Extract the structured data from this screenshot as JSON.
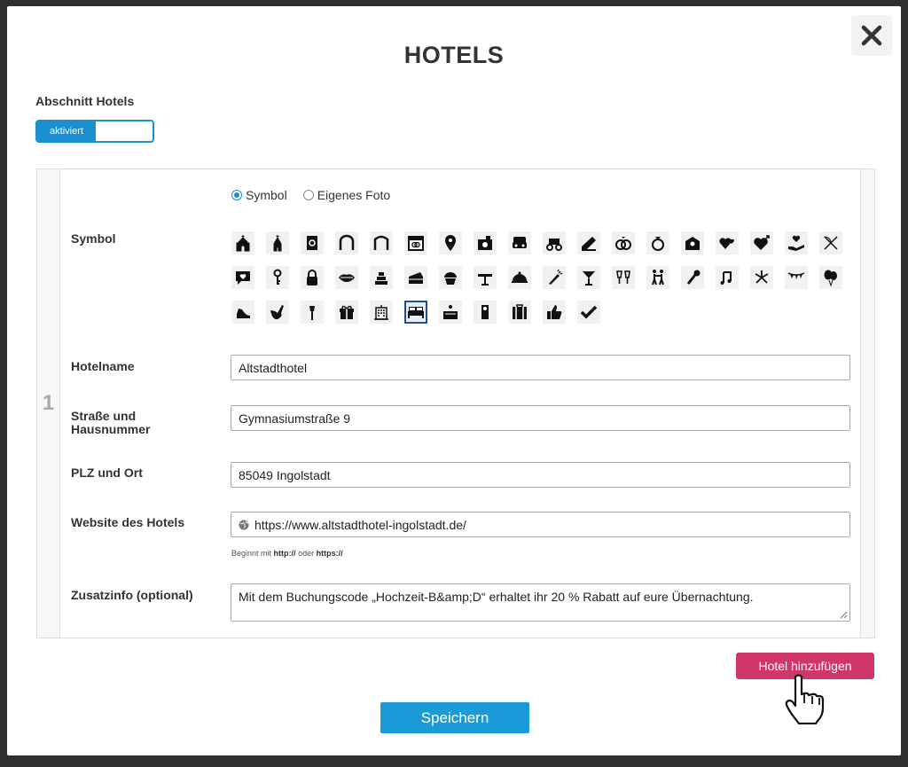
{
  "modal": {
    "title": "HOTELS",
    "section_label": "Abschnitt Hotels",
    "toggle_label": "aktiviert"
  },
  "hotel": {
    "index": "1",
    "radio_options": [
      {
        "label": "Symbol",
        "checked": true
      },
      {
        "label": "Eigenes Foto",
        "checked": false
      }
    ],
    "labels": {
      "symbol": "Symbol",
      "hotelname": "Hotelname",
      "street": "Straße und Hausnummer",
      "city": "PLZ und Ort",
      "website": "Website des Hotels",
      "extra": "Zusatzinfo (optional)"
    },
    "values": {
      "hotelname": "Altstadthotel",
      "street": "Gymnasiumstraße 9",
      "city": "85049 Ingolstadt",
      "website": "https://www.altstadthotel-ingolstadt.de/",
      "extra": "Mit dem Buchungscode „Hochzeit-B&amp;D“ erhaltet ihr 20 % Rabatt auf eure Übernachtung."
    },
    "hint": {
      "prefix": "Beginnt mit",
      "http": "http://",
      "or": "oder",
      "https": "https://"
    },
    "symbols": [
      "church-icon",
      "chapel-icon",
      "book-icon",
      "arch-icon",
      "gate-arch-icon",
      "calendar-rings-icon",
      "location-pin-icon",
      "camera-icon",
      "car-icon",
      "carriage-icon",
      "graduation-icon",
      "rings-icon",
      "diamond-ring-icon",
      "love-letter-icon",
      "hearts-icon",
      "heart-arrow-icon",
      "hand-heart-icon",
      "bow-arrow-icon",
      "chat-heart-icon",
      "key-icon",
      "lock-icon",
      "lips-icon",
      "wedding-cake-icon",
      "cake-slice-icon",
      "cupcake-icon",
      "cake-stand-icon",
      "cloche-icon",
      "champagne-icon",
      "cocktail-icon",
      "toast-glasses-icon",
      "dancing-couple-icon",
      "microphone-icon",
      "music-notes-icon",
      "fireworks-icon",
      "bunting-icon",
      "balloons-icon",
      "high-heel-icon",
      "dove-icon",
      "torch-icon",
      "gift-icon",
      "hotel-building-icon",
      "bed-icon",
      "reception-desk-icon",
      "door-hanger-icon",
      "luggage-icon",
      "thumbs-up-icon",
      "checkmark-icon"
    ],
    "selected_symbol": "bed-icon"
  },
  "actions": {
    "add_hotel": "Hotel hinzufügen",
    "save": "Speichern"
  },
  "colors": {
    "accent_blue": "#1a9ad6",
    "add_pink": "#d0366b",
    "selected_outline": "#1f4f8f"
  }
}
